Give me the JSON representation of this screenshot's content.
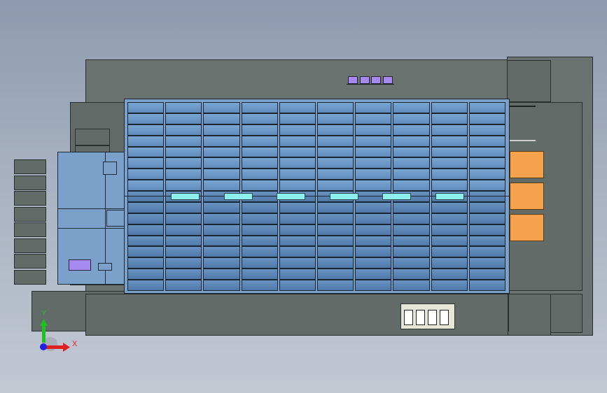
{
  "axes": {
    "x_label": "X",
    "y_label": "Y",
    "x_color": "#e02020",
    "y_color": "#20c020",
    "z_color": "#2020e0"
  },
  "colors": {
    "frame": "#6b7370",
    "panel": "#7ba0c9",
    "module_cell": "#6f9bcb",
    "cyan_bar": "#8ef0ec",
    "purple": "#a78af0",
    "orange": "#f5a24e"
  },
  "layout_counts": {
    "module_columns": 10,
    "module_rows": 17,
    "cyan_bars": 6,
    "purple_top_boxes": 4,
    "white_blocks": 4,
    "orange_boxes": 3,
    "left_stack_boxes": 8
  }
}
